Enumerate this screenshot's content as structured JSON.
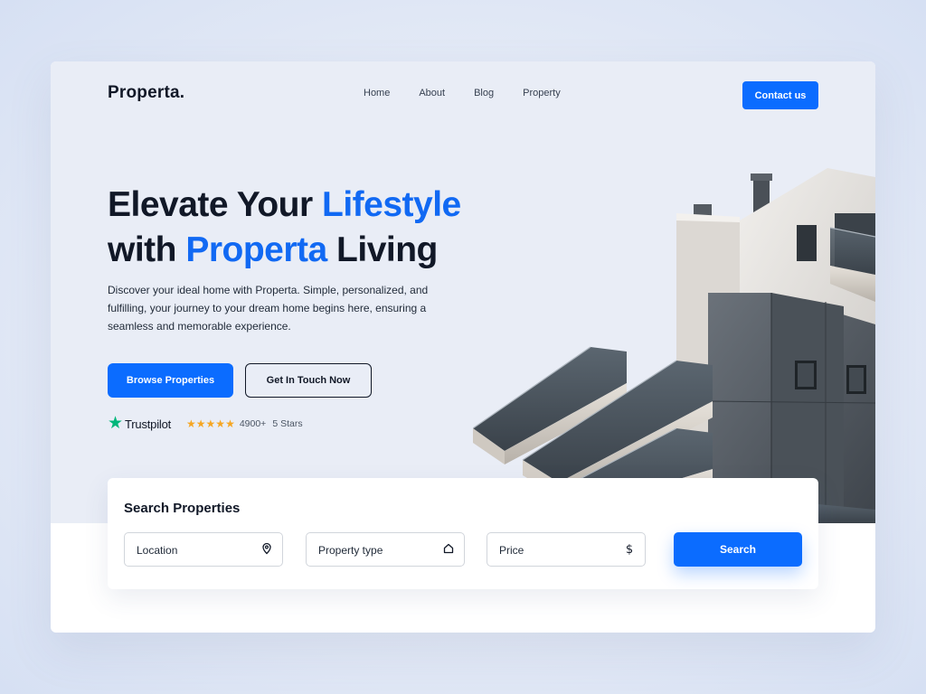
{
  "brand": {
    "logo": "Properta."
  },
  "nav": {
    "items": [
      "Home",
      "About",
      "Blog",
      "Property"
    ]
  },
  "header": {
    "contact_label": "Contact us"
  },
  "hero": {
    "headline_part1": "Elevate Your ",
    "headline_accent1": "Lifestyle",
    "headline_part2": "with ",
    "headline_accent2": "Properta",
    "headline_part3": " Living",
    "description": "Discover your ideal home with Properta. Simple, personalized, and fulfilling, your journey to your dream home begins here, ensuring a seamless and memorable experience.",
    "primary_cta": "Browse Properties",
    "secondary_cta": "Get In Touch Now"
  },
  "trust": {
    "brand": "Trustpilot",
    "stars_glyph": "★★★★★",
    "count": "4900+",
    "stars_label": "5 Stars"
  },
  "search": {
    "title": "Search Properties",
    "location_label": "Location",
    "type_label": "Property type",
    "price_label": "Price",
    "button_label": "Search"
  },
  "colors": {
    "accent": "#0b6cff",
    "headline_accent": "#1169f3",
    "trustpilot_green": "#00b67a",
    "star_gold": "#f5a623"
  },
  "icons": {
    "location": "map-pin-icon",
    "property_type": "home-icon",
    "price": "dollar-icon",
    "trustpilot": "trustpilot-star-icon"
  }
}
